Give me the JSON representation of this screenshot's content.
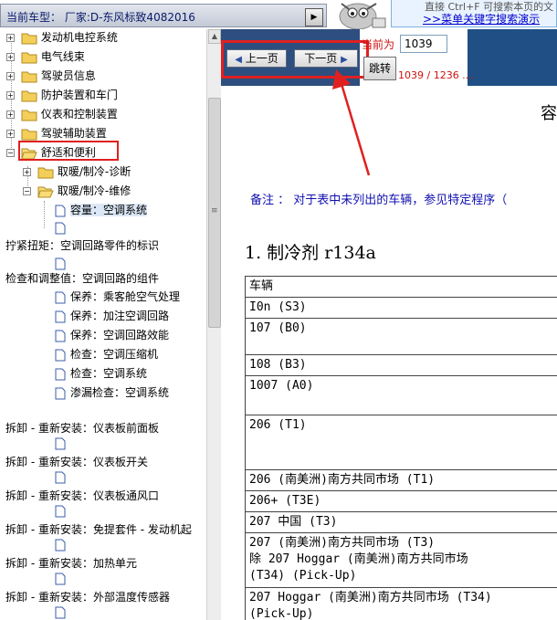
{
  "header": {
    "vehicle_label": "当前车型：  厂家:D-东风标致4082016",
    "collapse_icon": "▶",
    "tip_top": "直接 Ctrl+F 可搜索本页的文",
    "tip_link": ">>菜单关键字搜索演示"
  },
  "tree": {
    "items": [
      {
        "label": "发动机电控系统"
      },
      {
        "label": "电气线束"
      },
      {
        "label": "驾驶员信息"
      },
      {
        "label": "防护装置和车门"
      },
      {
        "label": "仪表和控制装置"
      },
      {
        "label": "驾驶辅助装置"
      },
      {
        "label": "舒适和便利"
      },
      {
        "label": "取暖/制冷-诊断"
      },
      {
        "label": "取暖/制冷-维修"
      },
      {
        "label": "容量：空调系统"
      },
      {
        "label": "拧紧扭矩：空调回路零件的标识"
      },
      {
        "label": "检查和调整值：空调回路的组件"
      },
      {
        "label": "保养：乘客舱空气处理"
      },
      {
        "label": "保养：加注空调回路"
      },
      {
        "label": "保养：空调回路效能"
      },
      {
        "label": "检查：空调压缩机"
      },
      {
        "label": "检查：空调系统"
      },
      {
        "label": "渗漏检查：空调系统"
      },
      {
        "label": "拆卸 - 重新安装：仪表板前面板"
      },
      {
        "label": "拆卸 - 重新安装：仪表板开关"
      },
      {
        "label": "拆卸 - 重新安装：仪表板通风口"
      },
      {
        "label": "拆卸 - 重新安装：免提套件 - 发动机起"
      },
      {
        "label": "拆卸 - 重新安装：加热单元"
      },
      {
        "label": "拆卸 - 重新安装：外部温度传感器"
      }
    ]
  },
  "nav": {
    "prev_label": "上一页",
    "next_label": "下一页",
    "current_label": "当前为",
    "page_value": "1039",
    "jump_label": "跳转",
    "page_count": "1039 / 1236 ...."
  },
  "content": {
    "partial_heading": "容",
    "note": "备注 ： 对于表中未列出的车辆，参见特定程序（",
    "section_title": "1. 制冷剂 r134a",
    "table_rows": [
      [
        "车辆"
      ],
      [
        "I0n (S3)"
      ],
      [
        "107 (B0)"
      ],
      [
        "108 (B3)"
      ],
      [
        "1007 (A0)"
      ],
      [
        "206 (T1)"
      ],
      [
        "206 (南美洲)南方共同市场 (T1)"
      ],
      [
        "206+ (T3E)"
      ],
      [
        "207 中国 (T3)"
      ],
      [
        "207 (南美洲)南方共同市场 (T3)",
        "除 207 Hoggar (南美洲)南方共同市场",
        "(T34) (Pick-Up)"
      ],
      [
        "207 Hoggar (南美洲)南方共同市场 (T34)",
        "(Pick-Up)"
      ]
    ]
  }
}
